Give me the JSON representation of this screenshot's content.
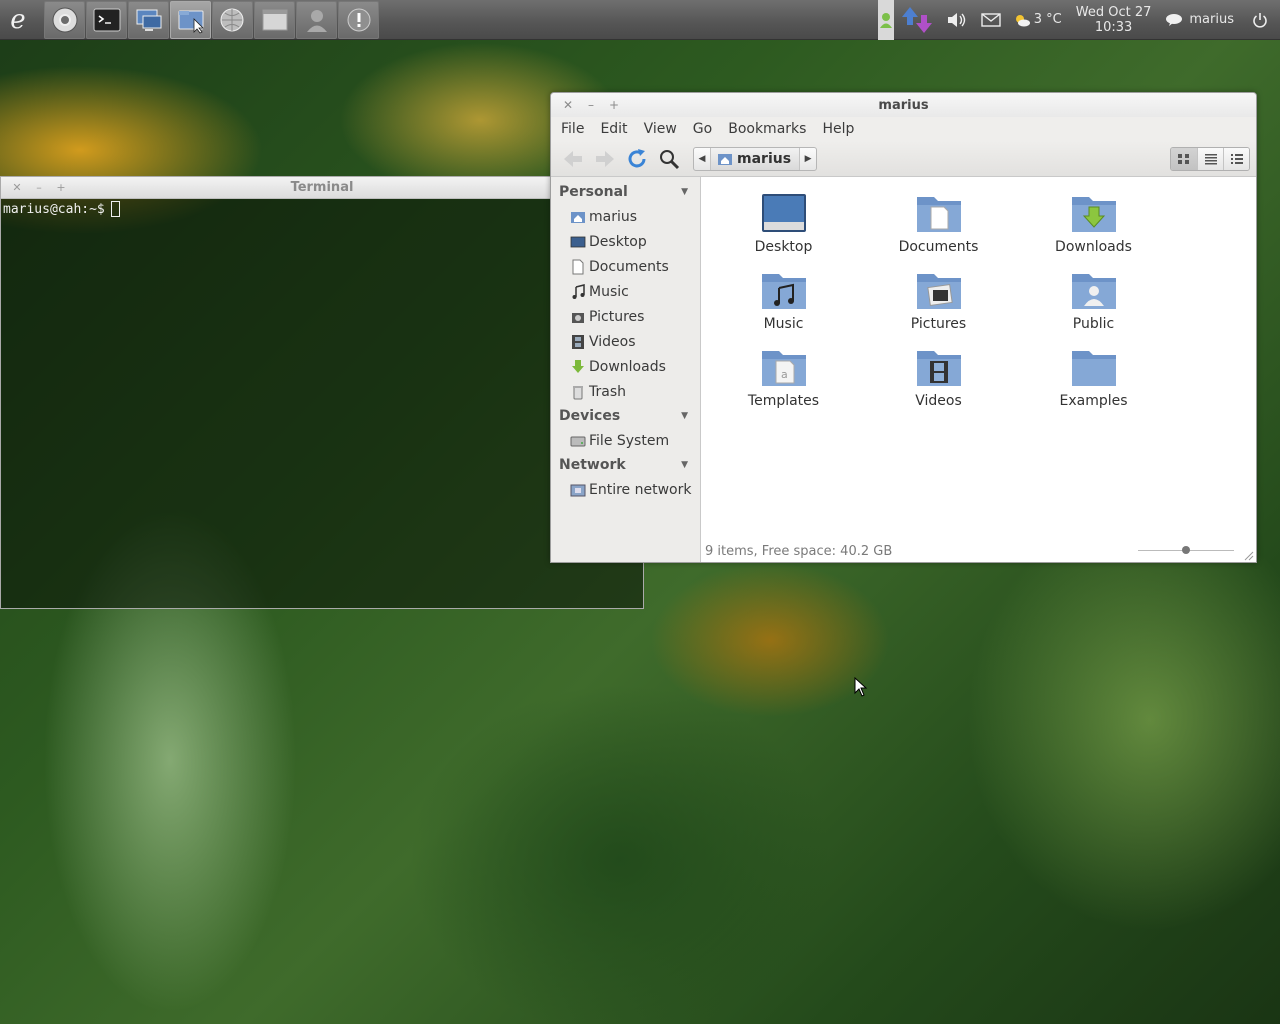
{
  "panel": {
    "logo_icon": "e-logo-icon",
    "launchers": [
      {
        "name": "chromium-launcher",
        "icon": "chromium-icon"
      },
      {
        "name": "terminal-launcher",
        "icon": "terminal-icon"
      },
      {
        "name": "workspace-launcher",
        "icon": "workspace-switcher-icon"
      },
      {
        "name": "file-manager-launcher",
        "icon": "file-manager-icon"
      },
      {
        "name": "network-launcher",
        "icon": "network-globe-icon"
      },
      {
        "name": "window-launcher",
        "icon": "window-icon"
      },
      {
        "name": "user-launcher",
        "icon": "user-icon"
      },
      {
        "name": "notification-launcher",
        "icon": "exclamation-icon"
      }
    ],
    "weather": "3 °C",
    "clock_date": "Wed Oct 27",
    "clock_time": "10:33",
    "user_name": "marius"
  },
  "terminal": {
    "title": "Terminal",
    "prompt": "marius@cah:~$"
  },
  "file_manager": {
    "title": "marius",
    "menu": [
      "File",
      "Edit",
      "View",
      "Go",
      "Bookmarks",
      "Help"
    ],
    "path_crumb": "marius",
    "sidebar": {
      "personal_header": "Personal",
      "personal_items": [
        "marius",
        "Desktop",
        "Documents",
        "Music",
        "Pictures",
        "Videos",
        "Downloads",
        "Trash"
      ],
      "devices_header": "Devices",
      "devices_items": [
        "File System"
      ],
      "network_header": "Network",
      "network_items": [
        "Entire network"
      ]
    },
    "items": [
      "Desktop",
      "Documents",
      "Downloads",
      "Music",
      "Pictures",
      "Public",
      "Templates",
      "Videos",
      "Examples"
    ],
    "status": "9 items, Free space: 40.2 GB",
    "zoom_level": 0.5,
    "accent": "#5a8ac6"
  }
}
